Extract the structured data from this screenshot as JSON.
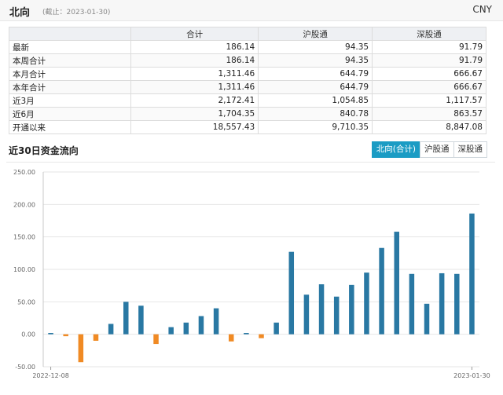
{
  "header": {
    "title": "北向",
    "date_note": "(截止：2023-01-30)",
    "currency": "CNY"
  },
  "summary_table": {
    "columns": [
      "",
      "合计",
      "沪股通",
      "深股通"
    ],
    "rows": [
      [
        "最新",
        "186.14",
        "94.35",
        "91.79"
      ],
      [
        "本周合计",
        "186.14",
        "94.35",
        "91.79"
      ],
      [
        "本月合计",
        "1,311.46",
        "644.79",
        "666.67"
      ],
      [
        "本年合计",
        "1,311.46",
        "644.79",
        "666.67"
      ],
      [
        "近3月",
        "2,172.41",
        "1,054.85",
        "1,117.57"
      ],
      [
        "近6月",
        "1,704.35",
        "840.78",
        "863.57"
      ],
      [
        "开通以来",
        "18,557.43",
        "9,710.35",
        "8,847.08"
      ]
    ]
  },
  "chart_section": {
    "title": "近30日资金流向",
    "tabs": [
      {
        "label": "北向(合计)",
        "active": true
      },
      {
        "label": "沪股通",
        "active": false
      },
      {
        "label": "深股通",
        "active": false
      }
    ]
  },
  "chart_data": {
    "type": "bar",
    "title": "",
    "xlabel": "",
    "ylabel": "",
    "ylim": [
      -50,
      250
    ],
    "yticks": [
      "-50.00",
      "0.00",
      "50.00",
      "100.00",
      "150.00",
      "200.00",
      "250.00"
    ],
    "x_tick_labels": [
      "2022-12-08",
      "2023-01-30"
    ],
    "values": [
      2,
      -3,
      -43,
      -10,
      16,
      50,
      44,
      -15,
      11,
      18,
      28,
      40,
      -11,
      2,
      -6,
      18,
      127,
      61,
      77,
      58,
      76,
      95,
      133,
      158,
      93,
      47,
      94,
      93,
      186
    ],
    "positive_color": "#2978a3",
    "negative_color": "#f08a24",
    "grid": true
  }
}
